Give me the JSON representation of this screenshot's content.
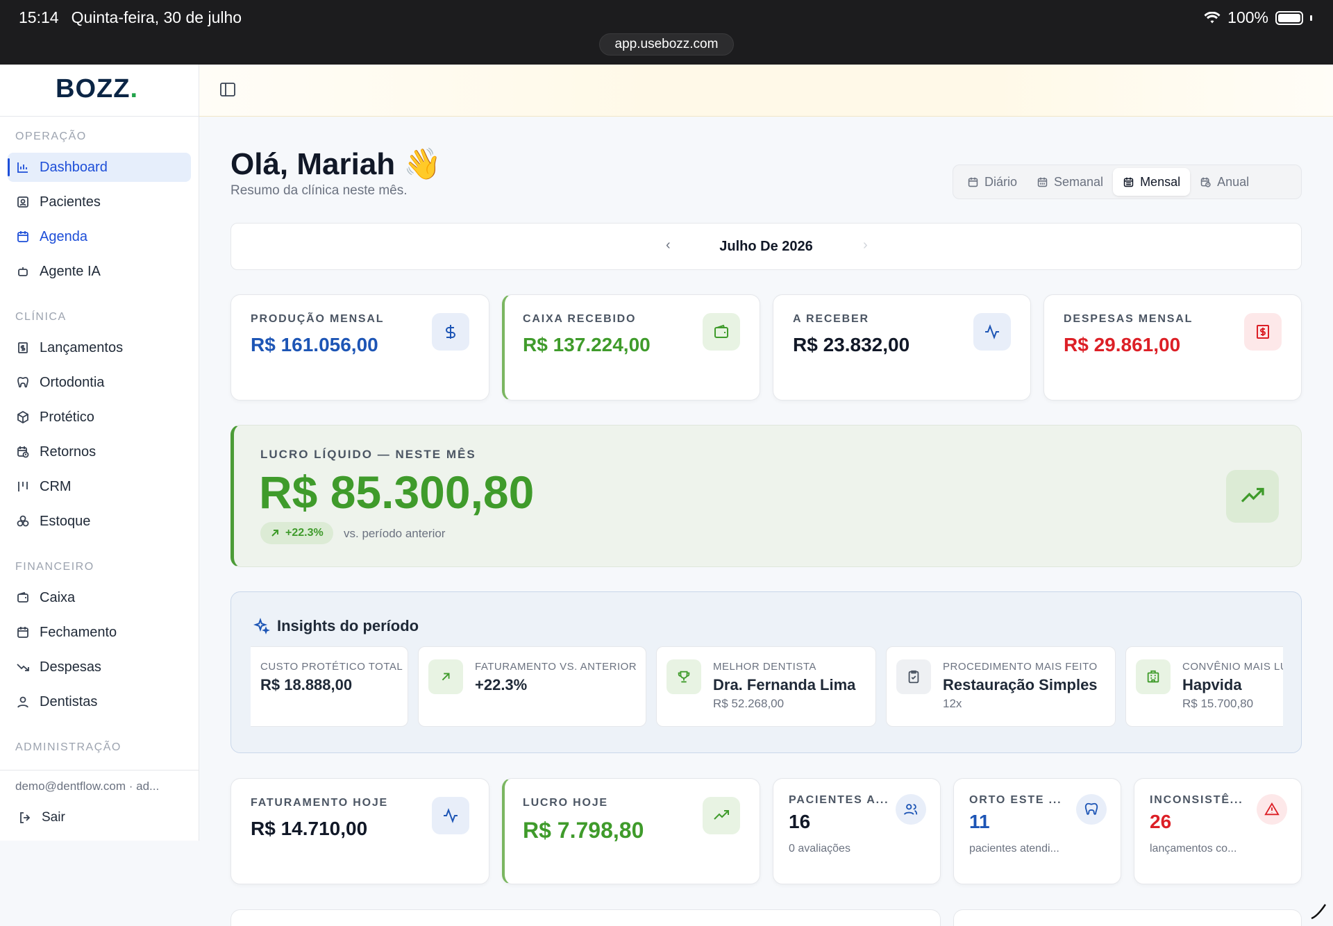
{
  "status_bar": {
    "time": "15:14",
    "date": "Quinta-feira, 30 de julho",
    "battery": "100%",
    "url": "app.usebozz.com"
  },
  "sidebar": {
    "logo": "BOZZ",
    "logo_dot": ".",
    "sections": {
      "operacao": "OPERAÇÃO",
      "clinica": "CLÍNICA",
      "financeiro": "FINANCEIRO",
      "administracao": "ADMINISTRAÇÃO"
    },
    "items": {
      "dashboard": "Dashboard",
      "pacientes": "Pacientes",
      "agenda": "Agenda",
      "agente_ia": "Agente IA",
      "lancamentos": "Lançamentos",
      "ortodontia": "Ortodontia",
      "protetico": "Protético",
      "retornos": "Retornos",
      "crm": "CRM",
      "estoque": "Estoque",
      "caixa": "Caixa",
      "fechamento": "Fechamento",
      "despesas": "Despesas",
      "dentistas": "Dentistas"
    },
    "user_email": "demo@dentflow.com · ad...",
    "logout": "Sair"
  },
  "header": {
    "greeting": "Olá, Mariah 👋",
    "subtitle": "Resumo da clínica neste mês.",
    "period_tabs": [
      "Diário",
      "Semanal",
      "Mensal",
      "Anual"
    ],
    "active_period": "Mensal",
    "month_label": "Julho De 2026",
    "prev": "‹",
    "next": "›"
  },
  "stats": [
    {
      "label": "PRODUÇÃO MENSAL",
      "value": "R$ 161.056,00",
      "color": "#1d55b5",
      "icon": "dollar-icon"
    },
    {
      "label": "CAIXA RECEBIDO",
      "value": "R$ 137.224,00",
      "color": "#3f9b2b",
      "icon": "wallet-icon"
    },
    {
      "label": "A RECEBER",
      "value": "R$ 23.832,00",
      "color": "#111827",
      "icon": "activity-icon"
    },
    {
      "label": "DESPESAS MENSAL",
      "value": "R$ 29.861,00",
      "color": "#dc1f26",
      "icon": "receipt-icon"
    }
  ],
  "profit": {
    "label": "LUCRO LÍQUIDO — NESTE MÊS",
    "value": "R$ 85.300,80",
    "badge": "+22.3%",
    "compare": "vs. período anterior"
  },
  "insights": {
    "title": "Insights do período",
    "items": [
      {
        "label": "CUSTO PROTÉTICO TOTAL",
        "value": "R$ 18.888,00",
        "sub": ""
      },
      {
        "label": "FATURAMENTO VS. ANTERIOR",
        "value": "+22.3%",
        "sub": ""
      },
      {
        "label": "MELHOR DENTISTA",
        "value": "Dra. Fernanda Lima",
        "sub": "R$ 52.268,00"
      },
      {
        "label": "PROCEDIMENTO MAIS FEITO",
        "value": "Restauração Simples",
        "sub": "12x"
      },
      {
        "label": "CONVÊNIO MAIS LU",
        "value": "Hapvida",
        "sub": "R$ 15.700,80"
      }
    ]
  },
  "today": [
    {
      "label": "FATURAMENTO HOJE",
      "value": "R$ 14.710,00",
      "color": "#111827"
    },
    {
      "label": "LUCRO HOJE",
      "value": "R$ 7.798,80",
      "color": "#3f9b2b"
    }
  ],
  "mini": [
    {
      "label": "PACIENTES A...",
      "value": "16",
      "sub": "0 avaliações",
      "color": "#111827"
    },
    {
      "label": "ORTO ESTE ...",
      "value": "11",
      "sub": "pacientes atendi...",
      "color": "#1d55b5"
    },
    {
      "label": "INCONSISTÊ...",
      "value": "26",
      "sub": "lançamentos co...",
      "color": "#dc1f26"
    }
  ]
}
